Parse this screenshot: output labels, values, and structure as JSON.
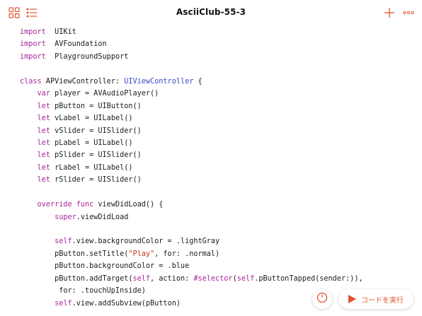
{
  "window": {
    "title": "AsciiClub-55-3"
  },
  "colors": {
    "accent": "#e2532d",
    "keyword": "#a8269b",
    "type": "#3b47c9",
    "string": "#c8361f"
  },
  "toolbar": {
    "left_icons": [
      "grid-icon",
      "list-icon"
    ],
    "right_icons": [
      "plus-icon",
      "more-icon"
    ]
  },
  "code_lines": [
    [
      [
        "kw",
        "import"
      ],
      [
        "",
        "  UIKit"
      ]
    ],
    [
      [
        "kw",
        "import"
      ],
      [
        "",
        "  AVFoundation"
      ]
    ],
    [
      [
        "kw",
        "import"
      ],
      [
        "",
        "  PlaygroundSupport"
      ]
    ],
    [],
    [
      [
        "kw",
        "class"
      ],
      [
        "",
        " APViewController: "
      ],
      [
        "ty",
        "UIViewController"
      ],
      [
        "",
        " {"
      ]
    ],
    [
      [
        "",
        "    "
      ],
      [
        "kw",
        "var"
      ],
      [
        "",
        " player = AVAudioPlayer()"
      ]
    ],
    [
      [
        "",
        "    "
      ],
      [
        "kw",
        "let"
      ],
      [
        "",
        " pButton = UIButton()"
      ]
    ],
    [
      [
        "",
        "    "
      ],
      [
        "kw",
        "let"
      ],
      [
        "",
        " vLabel = UILabel()"
      ]
    ],
    [
      [
        "",
        "    "
      ],
      [
        "kw",
        "let"
      ],
      [
        "",
        " vSlider = UISlider()"
      ]
    ],
    [
      [
        "",
        "    "
      ],
      [
        "kw",
        "let"
      ],
      [
        "",
        " pLabel = UILabel()"
      ]
    ],
    [
      [
        "",
        "    "
      ],
      [
        "kw",
        "let"
      ],
      [
        "",
        " pSlider = UISlider()"
      ]
    ],
    [
      [
        "",
        "    "
      ],
      [
        "kw",
        "let"
      ],
      [
        "",
        " rLabel = UILabel()"
      ]
    ],
    [
      [
        "",
        "    "
      ],
      [
        "kw",
        "let"
      ],
      [
        "",
        " rSlider = UISlider()"
      ]
    ],
    [],
    [
      [
        "",
        "    "
      ],
      [
        "kw",
        "override func"
      ],
      [
        "",
        " viewDidLoad() {"
      ]
    ],
    [
      [
        "",
        "        "
      ],
      [
        "kw",
        "super"
      ],
      [
        "",
        ".viewDidLoad"
      ]
    ],
    [],
    [
      [
        "",
        "        "
      ],
      [
        "kw",
        "self"
      ],
      [
        "",
        ".view.backgroundColor = .lightGray"
      ]
    ],
    [
      [
        "",
        "        pButton.setTitle("
      ],
      [
        "st",
        "\"Play\""
      ],
      [
        "",
        ", for: .normal)"
      ]
    ],
    [
      [
        "",
        "        pButton.backgroundColor = .blue"
      ]
    ],
    [
      [
        "",
        "        pButton.addTarget("
      ],
      [
        "kw",
        "self"
      ],
      [
        "",
        ", action: "
      ],
      [
        "sel",
        "#selector"
      ],
      [
        "",
        "("
      ],
      [
        "kw",
        "self"
      ],
      [
        "",
        ".pButtonTapped(sender:)),"
      ]
    ],
    [
      [
        "",
        "         for: .touchUpInside)"
      ]
    ],
    [
      [
        "",
        "        "
      ],
      [
        "kw",
        "self"
      ],
      [
        "",
        ".view.addSubview(pButton)"
      ]
    ]
  ],
  "run_button": {
    "label": "コードを実行"
  }
}
